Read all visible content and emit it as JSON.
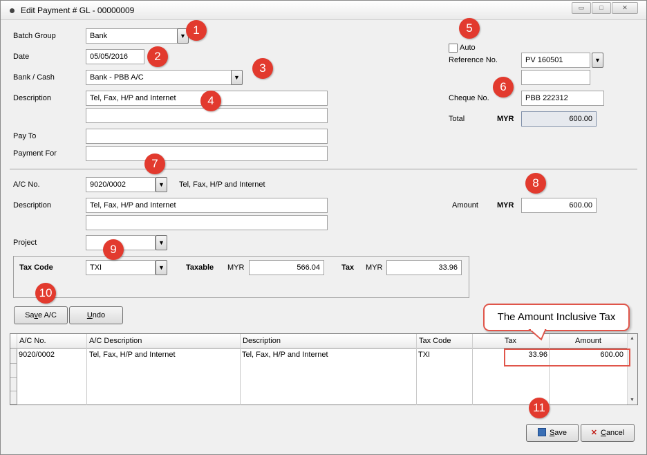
{
  "window": {
    "title": "Edit Payment # GL - 00000009",
    "controls": {
      "minimize": "▭",
      "maximize": "□",
      "close": "✕"
    }
  },
  "header": {
    "batch_group": {
      "label": "Batch Group",
      "value": "Bank"
    },
    "date": {
      "label": "Date",
      "value": "05/05/2016"
    },
    "bank_cash": {
      "label": "Bank / Cash",
      "value": "Bank - PBB A/C"
    },
    "description": {
      "label": "Description",
      "value": "Tel, Fax, H/P and Internet",
      "value2": ""
    },
    "pay_to": {
      "label": "Pay To",
      "value": ""
    },
    "payment_for": {
      "label": "Payment For",
      "value": ""
    },
    "auto": {
      "label": "Auto",
      "checked": false
    },
    "reference_no": {
      "label": "Reference No.",
      "value": "PV 160501",
      "value2": ""
    },
    "cheque_no": {
      "label": "Cheque No.",
      "value": "PBB 222312"
    },
    "total": {
      "label": "Total",
      "currency": "MYR",
      "value": "600.00"
    }
  },
  "detail": {
    "ac_no": {
      "label": "A/C No.",
      "value": "9020/0002",
      "desc_text": "Tel, Fax, H/P and Internet"
    },
    "description": {
      "label": "Description",
      "value": "Tel, Fax, H/P and Internet",
      "value2": ""
    },
    "amount": {
      "label": "Amount",
      "currency": "MYR",
      "value": "600.00"
    },
    "project": {
      "label": "Project",
      "value": ""
    },
    "tax": {
      "tax_code_label": "Tax Code",
      "tax_code": "TXI",
      "taxable_label": "Taxable",
      "taxable_currency": "MYR",
      "taxable_value": "566.04",
      "tax_label": "Tax",
      "tax_currency": "MYR",
      "tax_value": "33.96"
    }
  },
  "buttons": {
    "save_ac": {
      "pre": "Sa",
      "key": "v",
      "post": "e A/C"
    },
    "undo": {
      "pre": "",
      "key": "U",
      "post": "ndo"
    },
    "save": {
      "pre": "",
      "key": "S",
      "post": "ave"
    },
    "cancel": {
      "pre": "",
      "key": "C",
      "post": "ancel"
    }
  },
  "grid": {
    "columns": [
      "A/C No.",
      "A/C Description",
      "Description",
      "Tax Code",
      "Tax",
      "Amount"
    ],
    "rows": [
      {
        "ac_no": "9020/0002",
        "ac_desc": "Tel, Fax, H/P and Internet",
        "description": "Tel, Fax, H/P and Internet",
        "tax_code": "TXI",
        "tax": "33.96",
        "amount": "600.00"
      }
    ]
  },
  "annotations": {
    "callout": "The Amount Inclusive Tax",
    "markers": [
      "1",
      "2",
      "3",
      "4",
      "5",
      "6",
      "7",
      "8",
      "9",
      "10",
      "11"
    ],
    "accent_color": "#e23a2e"
  }
}
